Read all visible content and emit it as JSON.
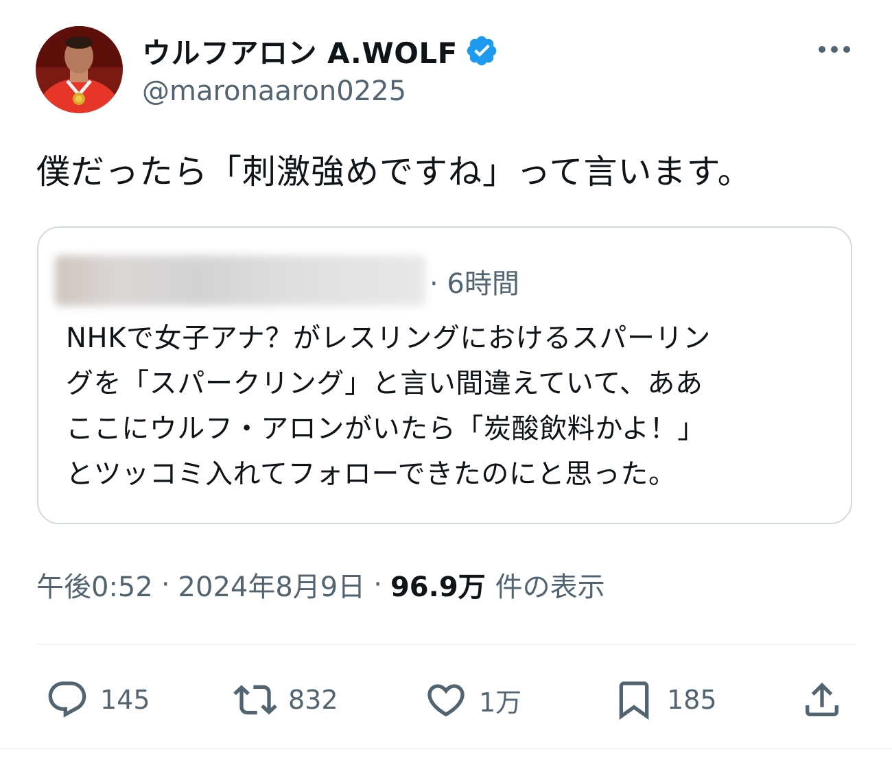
{
  "header": {
    "display_name": "ウルフアロン A.WOLF",
    "handle": "@maronaaron0225",
    "verified_icon": "verified-badge-icon",
    "more_icon": "more-horizontal-icon",
    "colors": {
      "verified": "#1d9bf0",
      "secondary": "#536471",
      "primary_text": "#0f1419"
    }
  },
  "tweet": {
    "text": "僕だったら「刺激強めですね」って言います。"
  },
  "quote": {
    "time": "· 6時間",
    "lines": [
      "NHKで女子アナ？がレスリングにおけるスパーリン",
      "グを「スパークリング」と言い間違えていて、ああ",
      "ここにウルフ・アロンがいたら「炭酸飲料かよ！」",
      "とツッコミ入れてフォローできたのにと思った。"
    ]
  },
  "meta": {
    "time": "午後0:52",
    "date": "2024年8月9日",
    "views": "96.9万",
    "views_label": "件の表示"
  },
  "actions": {
    "reply": {
      "icon": "reply-icon",
      "count": "145"
    },
    "retweet": {
      "icon": "retweet-icon",
      "count": "832"
    },
    "like": {
      "icon": "heart-icon",
      "count": "1万"
    },
    "bookmark": {
      "icon": "bookmark-icon",
      "count": "185"
    },
    "share": {
      "icon": "share-icon"
    }
  }
}
